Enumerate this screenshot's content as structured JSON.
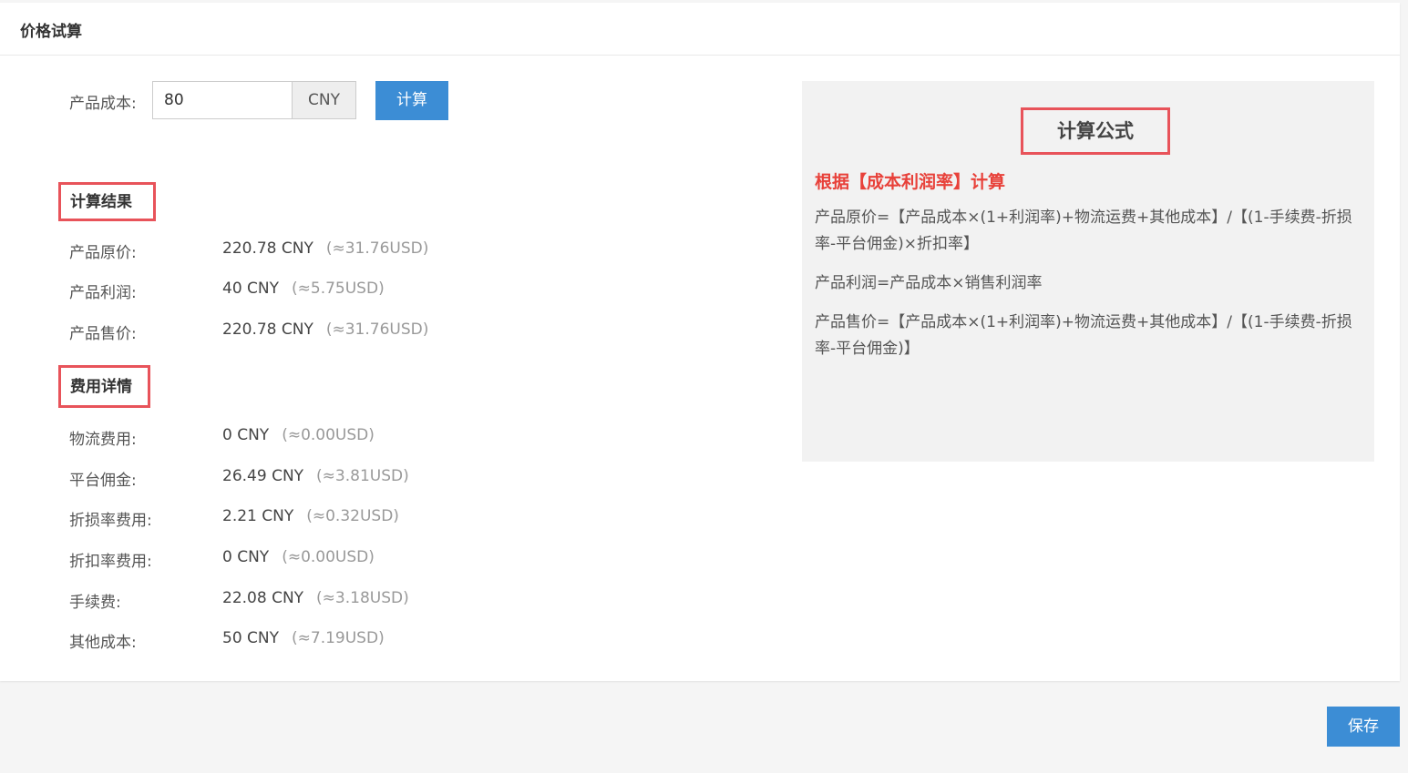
{
  "panel": {
    "title": "价格试算"
  },
  "cost_input": {
    "label": "产品成本:",
    "value": "80",
    "currency": "CNY",
    "calc_button": "计算"
  },
  "results": {
    "title": "计算结果",
    "rows": [
      {
        "label": "产品原价:",
        "value": "220.78 CNY",
        "usd": "(≈31.76USD)"
      },
      {
        "label": "产品利润:",
        "value": "40 CNY",
        "usd": "(≈5.75USD)"
      },
      {
        "label": "产品售价:",
        "value": "220.78 CNY",
        "usd": "(≈31.76USD)"
      }
    ]
  },
  "fees": {
    "title": "费用详情",
    "rows": [
      {
        "label": "物流费用:",
        "value": "0 CNY",
        "usd": "(≈0.00USD)"
      },
      {
        "label": "平台佣金:",
        "value": "26.49 CNY",
        "usd": "(≈3.81USD)"
      },
      {
        "label": "折损率费用:",
        "value": "2.21 CNY",
        "usd": "(≈0.32USD)"
      },
      {
        "label": "折扣率费用:",
        "value": "0 CNY",
        "usd": "(≈0.00USD)"
      },
      {
        "label": "手续费:",
        "value": "22.08 CNY",
        "usd": "(≈3.18USD)"
      },
      {
        "label": "其他成本:",
        "value": "50 CNY",
        "usd": "(≈7.19USD)"
      }
    ]
  },
  "formula": {
    "title": "计算公式",
    "basis": "根据【成本利润率】计算",
    "lines": [
      "产品原价=【产品成本×(1+利润率)+物流运费+其他成本】/【(1-手续费-折损率-平台佣金)×折扣率】",
      "产品利润=产品成本×销售利润率",
      "产品售价=【产品成本×(1+利润率)+物流运费+其他成本】/【(1-手续费-折损率-平台佣金)】"
    ]
  },
  "footer": {
    "save_button": "保存"
  },
  "colors": {
    "primary": "#3c8dd5",
    "highlight_border": "#e8535a",
    "basis_text": "#e8413a"
  }
}
